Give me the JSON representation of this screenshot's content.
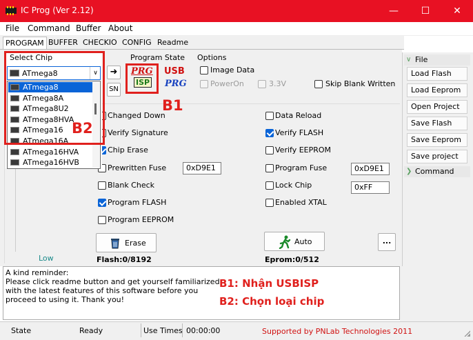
{
  "window": {
    "title": "IC Prog (Ver 2.12)"
  },
  "menu": [
    "File",
    "Command",
    "Buffer",
    "About"
  ],
  "tabs": [
    "PROGRAM",
    "BUFFER",
    "CHECKIO",
    "CONFIG",
    "Readme"
  ],
  "select_chip": {
    "label": "Select Chip",
    "selected": "ATmega8",
    "options": [
      "ATmega8",
      "ATmega8A",
      "ATmega8U2",
      "ATmega8HVA",
      "ATmega16",
      "ATmega16A",
      "ATmega16HVA",
      "ATmega16HVB"
    ],
    "highlighted": "ATmega8"
  },
  "program_state": {
    "label": "Program State",
    "prg_isp_top": "PRG",
    "prg_isp_bottom": "ISP",
    "usb_top": "USB",
    "usb_bottom": "PRG"
  },
  "options": {
    "label": "Options",
    "image_data": "Image Data",
    "power_on": "PowerOn",
    "voltage": "3.3V",
    "skip_blank": "Skip Blank Written"
  },
  "sn_button": "SN",
  "left_options": [
    {
      "label": "Changed Down",
      "checked": false
    },
    {
      "label": "Verify Signature",
      "checked": false
    },
    {
      "label": "Chip Erase",
      "checked": true
    },
    {
      "label": "Prewritten Fuse",
      "checked": false,
      "value": "0xD9E1"
    },
    {
      "label": "Blank Check",
      "checked": false
    },
    {
      "label": "Program FLASH",
      "checked": true
    },
    {
      "label": "Program EEPROM",
      "checked": false
    }
  ],
  "right_options": [
    {
      "label": "Data Reload",
      "checked": false
    },
    {
      "label": "Verify FLASH",
      "checked": true
    },
    {
      "label": "Verify EEPROM",
      "checked": false
    },
    {
      "label": "Program Fuse",
      "checked": false,
      "value": "0xD9E1"
    },
    {
      "label": "Lock Chip",
      "checked": false,
      "value": "0xFF"
    },
    {
      "label": "Enabled XTAL",
      "checked": false
    }
  ],
  "erase_button": "Erase",
  "auto_button": "Auto",
  "more_button": "...",
  "flash_info": "Flash:0/8192",
  "eprom_info": "Eprom:0/512",
  "level_label": "Low",
  "reminder": [
    "A kind reminder:",
    "Please click readme button and get yourself familiarized",
    "with the latest features of this software before you",
    "proceed to using it. Thank you!"
  ],
  "annotations": {
    "b1": "B1",
    "b2": "B2",
    "step1": "B1: Nhận USBISP",
    "step2": "B2: Chọn loại chip"
  },
  "right_panel": {
    "file_header": "File",
    "buttons": [
      "Load Flash",
      "Load Eeprom",
      "Open Project",
      "Save Flash",
      "Save Eeprom",
      "Save project"
    ],
    "command_header": "Command"
  },
  "status": {
    "state_label": "State",
    "state_value": "Ready",
    "use_times_label": "Use Times",
    "use_times_value": "00:00:00",
    "credit": "Supported by PNLab Technologies 2011"
  },
  "colors": {
    "title_bar": "#e81123",
    "annotation": "#e0201d",
    "accent": "#0a64d7",
    "credit": "#d01010"
  }
}
